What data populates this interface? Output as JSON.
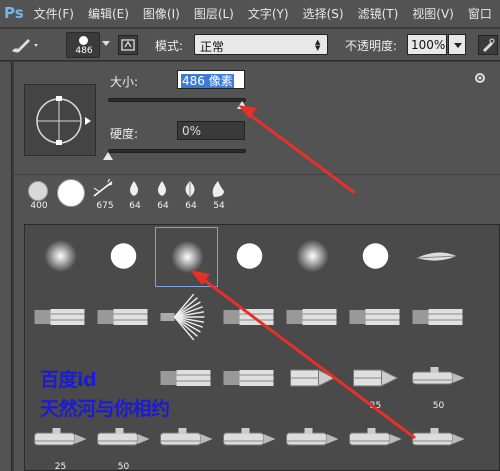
{
  "app": {
    "logo": "Ps"
  },
  "menu": [
    {
      "label": "文件(F)"
    },
    {
      "label": "编辑(E)"
    },
    {
      "label": "图像(I)"
    },
    {
      "label": "图层(L)"
    },
    {
      "label": "文字(Y)"
    },
    {
      "label": "选择(S)"
    },
    {
      "label": "滤镜(T)"
    },
    {
      "label": "视图(V)"
    },
    {
      "label": "窗口"
    }
  ],
  "options": {
    "brush_size": "486",
    "mode_label": "模式:",
    "mode_value": "正常",
    "opacity_label": "不透明度:",
    "opacity_value": "100%"
  },
  "popup": {
    "size_label": "大小:",
    "size_value": "486 像素",
    "size_fraction": 0.97,
    "hardness_label": "硬度:",
    "hardness_value": "0%",
    "hardness_fraction": 0.0
  },
  "recent_brushes": [
    {
      "label": "400",
      "icon": "soft-round-icon"
    },
    {
      "label": "",
      "icon": "hard-round-icon"
    },
    {
      "label": "675",
      "icon": "scatter-icon"
    },
    {
      "label": "64",
      "icon": "drop-icon"
    },
    {
      "label": "64",
      "icon": "drop-icon"
    },
    {
      "label": "64",
      "icon": "leaf-icon"
    },
    {
      "label": "54",
      "icon": "flame-icon"
    }
  ],
  "brush_grid": {
    "rows": [
      [
        "soft",
        "hard",
        "soft",
        "hard",
        "soft",
        "hard",
        "bristle"
      ],
      [
        "flat-bristle",
        "flat",
        "fan",
        "flat",
        "flat",
        "flat",
        "flat"
      ],
      [
        "",
        "",
        "flat",
        "flat",
        "pencil",
        "pencil",
        "airbrush"
      ],
      [
        "airbrush",
        "airbrush",
        "airbrush",
        "airbrush",
        "airbrush",
        "airbrush",
        "airbrush"
      ]
    ],
    "labels": {
      "2-5": "25",
      "2-6": "50",
      "3-0": "25",
      "3-1": "50"
    },
    "selected": "0-2"
  },
  "watermark": {
    "line1": "百度id",
    "line2": "天然河与你相约"
  },
  "colors": {
    "annotation": "#e8302a",
    "watermark": "#1b1bd6",
    "selection": "#3d7bd9"
  }
}
